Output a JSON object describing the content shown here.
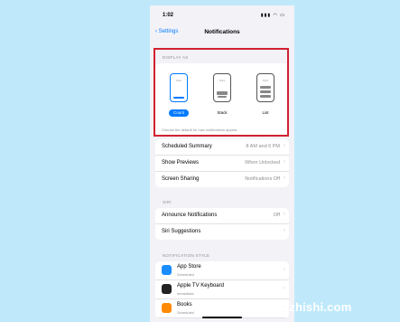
{
  "status_bar": {
    "time": "1:02"
  },
  "nav": {
    "back_label": "Settings",
    "title": "Notifications"
  },
  "display_as": {
    "label": "DISPLAY AS",
    "options": [
      {
        "name": "Count",
        "clock": "9:41",
        "selected": true
      },
      {
        "name": "Stack",
        "clock": "9:41",
        "selected": false
      },
      {
        "name": "List",
        "clock": "9:41",
        "selected": false
      }
    ],
    "description": "Choose the default for how notifications appear."
  },
  "settings_group": [
    {
      "label": "Scheduled Summary",
      "value": "8 AM and 6 PM"
    },
    {
      "label": "Show Previews",
      "value": "When Unlocked"
    },
    {
      "label": "Screen Sharing",
      "value": "Notifications Off"
    }
  ],
  "siri": {
    "label": "SIRI",
    "rows": [
      {
        "label": "Announce Notifications",
        "value": "Off"
      },
      {
        "label": "Siri Suggestions",
        "value": ""
      }
    ]
  },
  "notification_style": {
    "label": "NOTIFICATION STYLE",
    "apps": [
      {
        "name": "App Store",
        "sub": "Scheduled",
        "icon": "app-store-icon",
        "color": "#1a8cff"
      },
      {
        "name": "Apple TV Keyboard",
        "sub": "Immediate",
        "icon": "tv-keyboard-icon",
        "color": "#222222"
      },
      {
        "name": "Books",
        "sub": "Scheduled",
        "icon": "books-icon",
        "color": "#ff8a00"
      }
    ]
  },
  "watermark": "jonmazhishi.com"
}
